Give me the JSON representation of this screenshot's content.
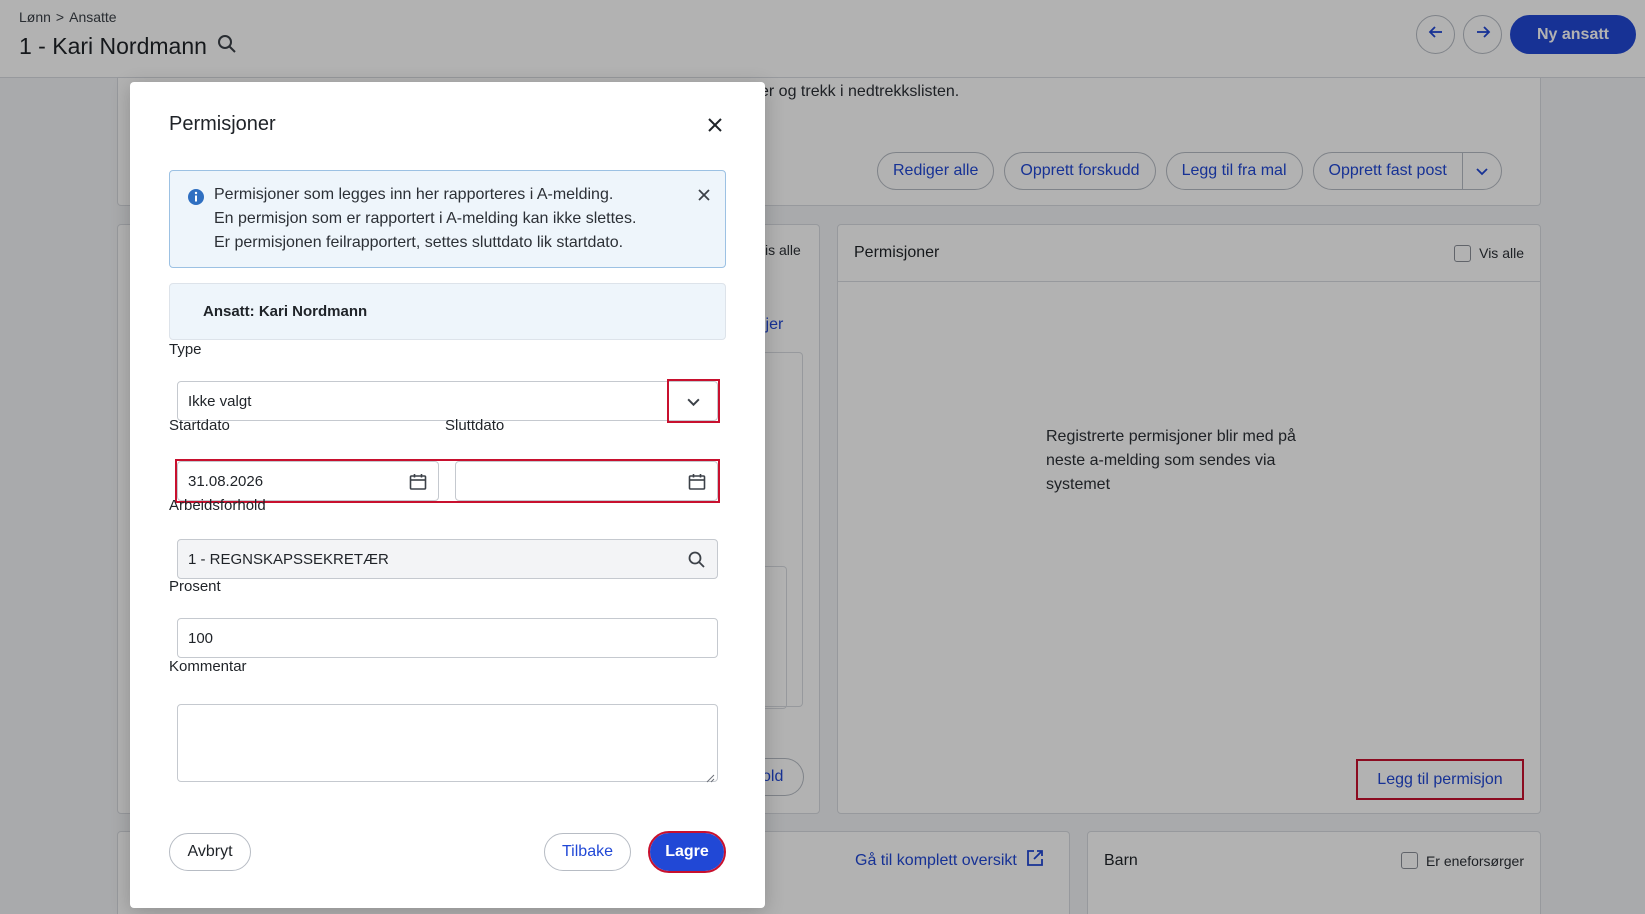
{
  "header": {
    "breadcrumb": [
      "Lønn",
      "Ansatte"
    ],
    "breadcrumb_separator": ">",
    "title": "1 - Kari Nordmann",
    "prev_label": "←",
    "next_label": "→",
    "new_employee_label": "Ny ansatt"
  },
  "background": {
    "intro_text_partial": "er og trekk i nedtrekkslisten.",
    "toolbar": {
      "edit_all": "Rediger alle",
      "create_advance": "Opprett forskudd",
      "add_from_template": "Legg til fra mal",
      "create_fixed_post": "Opprett fast post"
    },
    "left_card": {
      "show_all_partial": "is alle",
      "link_partial": "ljer",
      "button_partial": "old"
    },
    "permissions_card": {
      "title": "Permisjoner",
      "show_all": "Vis alle",
      "empty_text": "Registrerte permisjoner blir med på neste a-melding som sendes via systemet",
      "add_button": "Legg til permisjon"
    },
    "overview_link": "Gå til komplett oversikt",
    "children_card": {
      "title": "Barn",
      "single_provider": "Er eneforsørger"
    }
  },
  "modal": {
    "title": "Permisjoner",
    "info_lines": [
      "Permisjoner som legges inn her rapporteres i A-melding.",
      "En permisjon som er rapportert i A-melding kan ikke slettes.",
      "Er permisjonen feilrapportert, settes sluttdato lik startdato."
    ],
    "employee_label": "Ansatt: Kari Nordmann",
    "type": {
      "label": "Type",
      "value": "Ikke valgt"
    },
    "start_date": {
      "label": "Startdato",
      "value": "31.08.2026"
    },
    "end_date": {
      "label": "Sluttdato",
      "value": ""
    },
    "employment": {
      "label": "Arbeidsforhold",
      "value": "1 - REGNSKAPSSEKRETÆR"
    },
    "percent": {
      "label": "Prosent",
      "value": "100"
    },
    "comment": {
      "label": "Kommentar",
      "value": ""
    },
    "cancel_label": "Avbryt",
    "back_label": "Tilbake",
    "save_label": "Lagre"
  },
  "colors": {
    "primary": "#2148d6",
    "highlight": "#c8102e",
    "info_bg": "#eef5fb",
    "info_icon": "#2f6fc1"
  },
  "icons": [
    "search-icon",
    "arrow-left-icon",
    "arrow-right-icon",
    "chevron-down-icon",
    "close-icon",
    "info-icon",
    "calendar-icon",
    "external-link-icon"
  ]
}
